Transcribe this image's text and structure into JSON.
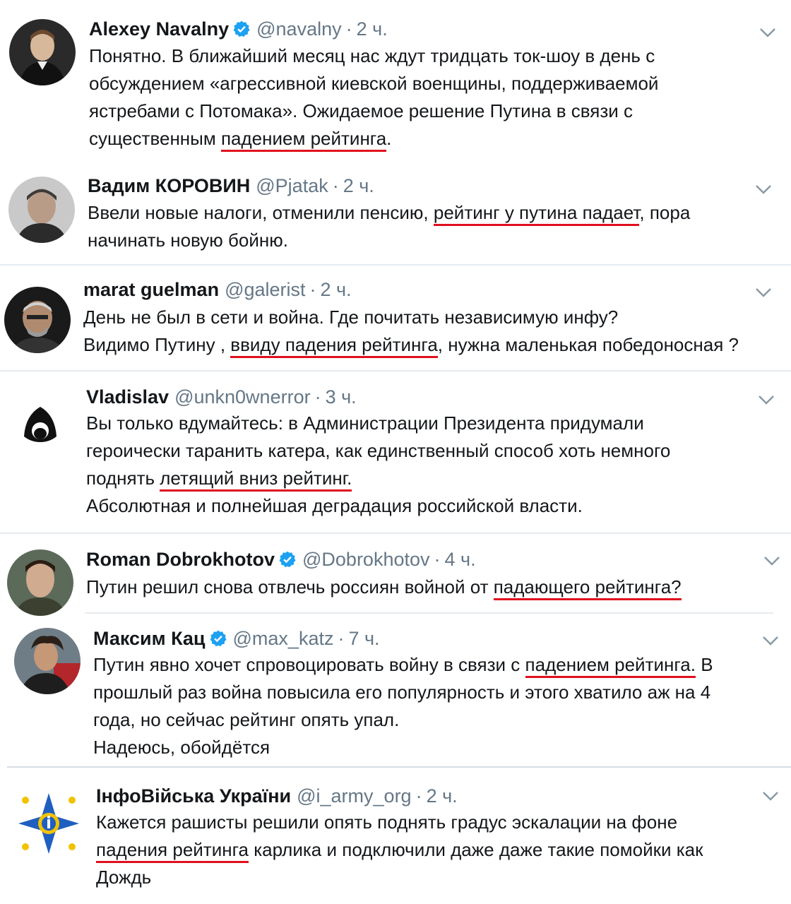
{
  "tweets": [
    {
      "name": "Alexey Navalny",
      "verified": true,
      "handle": "@navalny",
      "time": "2 ч.",
      "lines": [
        [
          "Понятно. В ближайший месяц нас ждут тридцать ток-шоу в день с"
        ],
        [
          "обсуждением «агрессивной киевской военщины, поддерживаемой"
        ],
        [
          "ястребами с Потомака». Ожидаемое решение Путина в связи с"
        ],
        [
          "существенным ",
          {
            "hl": "падением рейтинга"
          },
          "."
        ]
      ]
    },
    {
      "name": "Вадим КОРОВИН",
      "verified": false,
      "handle": "@Pjatak",
      "time": "2 ч.",
      "lines": [
        [
          "Ввели новые налоги, отменили пенсию, ",
          {
            "hl": "рейтинг у путина падает"
          },
          ", пора"
        ],
        [
          "начинать новую бойню."
        ]
      ]
    },
    {
      "name": "marat guelman",
      "verified": false,
      "handle": "@galerist",
      "time": "2 ч.",
      "lines": [
        [
          "День не был в сети и война. Где почитать независимую инфу?"
        ],
        [
          "Видимо Путину , ",
          {
            "hl": "ввиду падения рейтинга"
          },
          ", нужна маленькая победоносная ?"
        ]
      ]
    },
    {
      "name": "Vladislav",
      "verified": false,
      "handle": "@unkn0wnerror",
      "time": "3 ч.",
      "lines": [
        [
          "Вы только вдумайтесь: в Администрации Президента придумали"
        ],
        [
          "героически таранить катера, как единственный способ хоть немного"
        ],
        [
          "поднять ",
          {
            "hl": "летящий вниз рейтинг."
          }
        ],
        [
          "Абсолютная и полнейшая деградация российской власти."
        ]
      ]
    },
    {
      "name": "Roman Dobrokhotov",
      "verified": true,
      "handle": "@Dobrokhotov",
      "time": "4 ч.",
      "lines": [
        [
          "Путин решил снова отвлечь россиян войной от ",
          {
            "hl": "падающего рейтинга?"
          }
        ]
      ]
    },
    {
      "name": "Максим Кац",
      "verified": true,
      "handle": "@max_katz",
      "time": "7 ч.",
      "lines": [
        [
          "Путин явно хочет спровоцировать войну в связи с ",
          {
            "hl": "падением рейтинга."
          },
          " В"
        ],
        [
          "прошлый раз война повысила его популярность и этого хватило аж на 4"
        ],
        [
          "года, но сейчас рейтинг опять упал."
        ],
        [
          "Надеюсь, обойдётся"
        ]
      ]
    },
    {
      "name": "ІнфоВійська України",
      "verified": false,
      "handle": "@i_army_org",
      "time": "2 ч.",
      "lines": [
        [
          "Кажется рашисты решили опять поднять градус эскалации на фоне"
        ],
        [
          {
            "hl": "падения рейтинга"
          },
          " карлика и подключили даже даже такие помойки как"
        ],
        [
          "Дождь"
        ]
      ]
    }
  ],
  "separator_dot": "·",
  "colors": {
    "highlight": "#e0101e",
    "muted": "#657786",
    "verified": "#1da1f2"
  }
}
